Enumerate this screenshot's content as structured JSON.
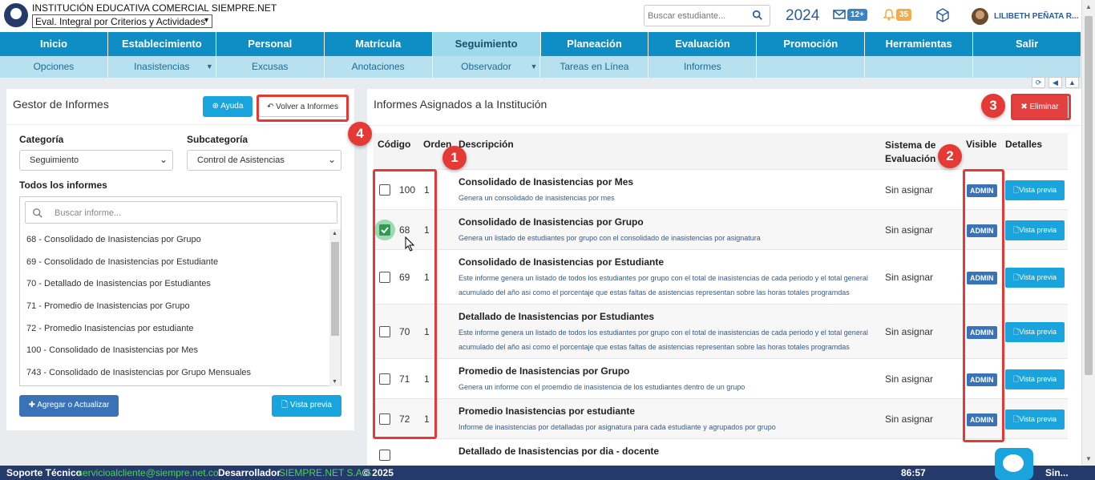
{
  "header": {
    "institution": "INSTITUCIÓN EDUCATIVA COMERCIAL SIEMPRE.NET",
    "eval_select": "Eval. Integral por Criterios y Actividades",
    "search_placeholder": "Buscar estudiante...",
    "year": "2024",
    "mail_badge": "12+",
    "bell_badge": "35",
    "username": "LILIBETH PEÑATA R..."
  },
  "main_nav": [
    "Inicio",
    "Establecimiento",
    "Personal",
    "Matrícula",
    "Seguimiento",
    "Planeación",
    "Evaluación",
    "Promoción",
    "Herramientas",
    "Salir"
  ],
  "main_nav_active": "Seguimiento",
  "sub_nav": [
    {
      "label": "Opciones",
      "caret": false
    },
    {
      "label": "Inasistencias",
      "caret": true
    },
    {
      "label": "Excusas",
      "caret": false
    },
    {
      "label": "Anotaciones",
      "caret": false
    },
    {
      "label": "Observador",
      "caret": true
    },
    {
      "label": "Tareas en Línea",
      "caret": false
    },
    {
      "label": "Informes",
      "caret": false
    },
    {
      "label": "",
      "caret": false
    },
    {
      "label": "",
      "caret": false
    },
    {
      "label": "",
      "caret": false
    }
  ],
  "left_panel": {
    "title": "Gestor de Informes",
    "help_button": "Ayuda",
    "back_button": "Volver a Informes",
    "category_label": "Categoría",
    "category_value": "Seguimiento",
    "subcategory_label": "Subcategoría",
    "subcategory_value": "Control de Asistencias",
    "all_reports_label": "Todos los informes",
    "search_placeholder": "Buscar informe...",
    "reports": [
      "68 - Consolidado de Inasistencias por Grupo",
      "69 - Consolidado de Inasistencias por Estudiante",
      "70 - Detallado de Inasistencias por Estudiantes",
      "71 - Promedio de Inasistencias por Grupo",
      "72 - Promedio Inasistencias por estudiante",
      "100 - Consolidado de Inasistencias por Mes",
      "743 - Consolidado de Inasistencias por Grupo Mensuales"
    ],
    "add_button": "Agregar o Actualizar",
    "preview_button": "Vista previa"
  },
  "right_panel": {
    "title": "Informes Asignados a la Institución",
    "delete_button": "Eliminar",
    "columns": {
      "code": "Código",
      "order": "Orden",
      "description": "Descripción",
      "eval_system": "Sistema de Evaluación",
      "visible": "Visible",
      "details": "Detalles"
    },
    "rows": [
      {
        "checked": false,
        "code": "100",
        "order": "1",
        "title": "Consolidado de Inasistencias por Mes",
        "desc": "Genera un consolidado de inasistencias por mes",
        "system": "Sin asignar",
        "visible": "ADMIN",
        "details": "Vista previa"
      },
      {
        "checked": true,
        "code": "68",
        "order": "1",
        "title": "Consolidado de Inasistencias por Grupo",
        "desc": "Genera un listado de estudiantes por grupo con el consolidado de inasistencias por asignatura",
        "system": "Sin asignar",
        "visible": "ADMIN",
        "details": "Vista previa"
      },
      {
        "checked": false,
        "code": "69",
        "order": "1",
        "title": "Consolidado de Inasistencias por Estudiante",
        "desc": "Este informe genera un listado de todos los estudiantes por grupo con el total de inasistencias de cada periodo y el total general acumulado del año asi como el porcentaje que estas faltas de asistencias representan sobre las horas totales programdas",
        "system": "Sin asignar",
        "visible": "ADMIN",
        "details": "Vista previa"
      },
      {
        "checked": false,
        "code": "70",
        "order": "1",
        "title": "Detallado de Inasistencias por Estudiantes",
        "desc": "Este informe genera un listado de todos los estudiantes por grupo con el total de inasistencias de cada periodo y el total general acumulado del año asi como el porcentaje que estas faltas de asistencias representan sobre las horas totales programdas",
        "system": "Sin asignar",
        "visible": "ADMIN",
        "details": "Vista previa"
      },
      {
        "checked": false,
        "code": "71",
        "order": "1",
        "title": "Promedio de Inasistencias por Grupo",
        "desc": "Genera un informe con el proemdio de inasistencia de los estudiantes dentro de un grupo",
        "system": "Sin asignar",
        "visible": "ADMIN",
        "details": "Vista previa"
      },
      {
        "checked": false,
        "code": "72",
        "order": "1",
        "title": "Promedio Inasistencias por estudiante",
        "desc": "Informe de inasistencias por detalladas por asignatura para cada estudiante y agrupados por grupo",
        "system": "Sin asignar",
        "visible": "ADMIN",
        "details": "Vista previa"
      },
      {
        "checked": false,
        "code": "",
        "order": "",
        "title": "Detallado de Inasistencias por dia - docente",
        "desc": "",
        "system": "",
        "visible": "",
        "details": ""
      }
    ]
  },
  "callouts": [
    "1",
    "2",
    "3",
    "4"
  ],
  "footer": {
    "support_label": "Soporte Técnico",
    "support_email": "servicioalcliente@siempre.net.co",
    "dev_label": "Desarrollador",
    "dev_name": "SIEMPRE.NET S.A.S",
    "copyright": "© 2025",
    "timer": "86:57",
    "brand": "Sin..."
  },
  "colors": {
    "nav_blue": "#0e8ec5",
    "nav_active": "#9fd9ec",
    "subnav": "#b7e1ef",
    "annotation_red": "#e53935",
    "footer": "#243a6b"
  }
}
